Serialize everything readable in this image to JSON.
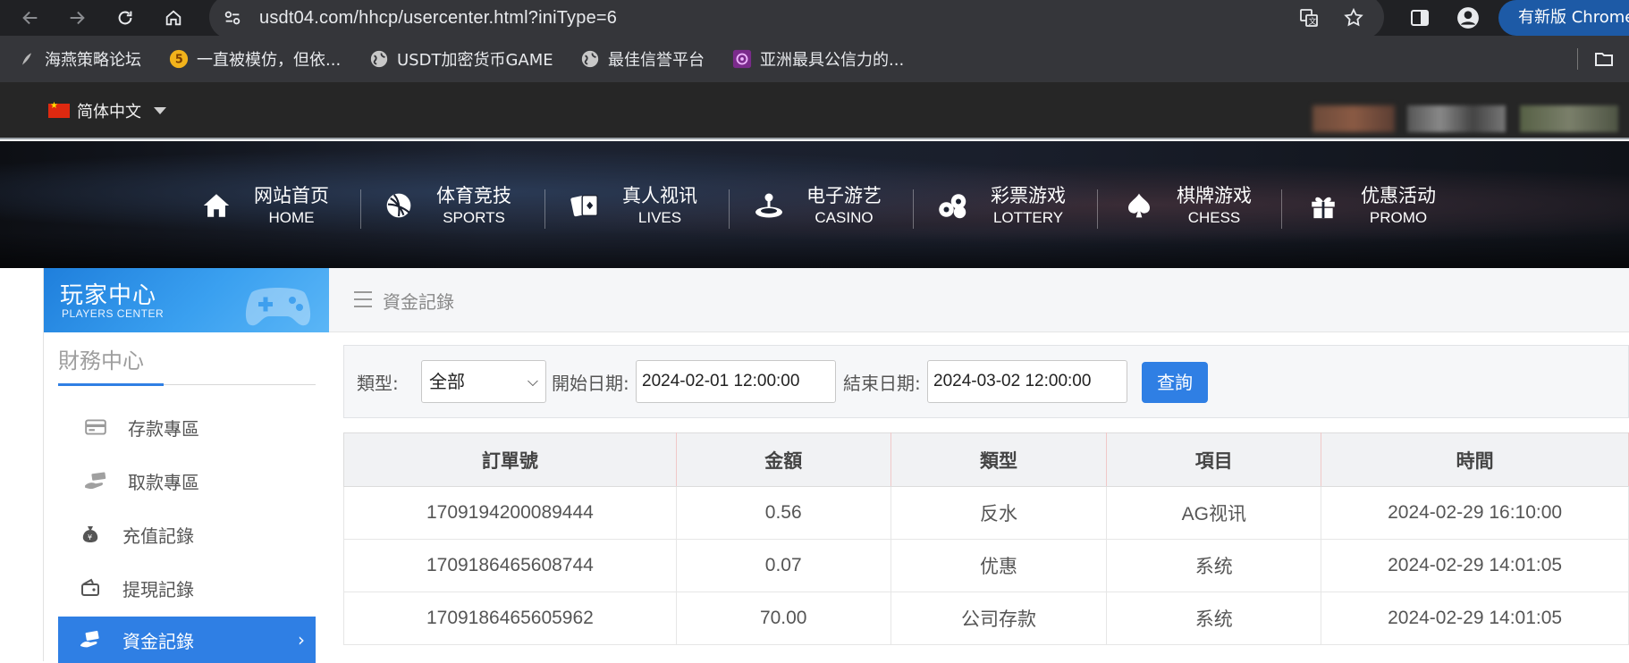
{
  "browser": {
    "url": "usdt04.com/hhcp/usercenter.html?iniType=6",
    "update_label": "有新版 Chrome",
    "bookmarks": [
      {
        "label": "海燕策略论坛"
      },
      {
        "label": "一直被模仿，但依..."
      },
      {
        "label": "USDT加密货币GAME"
      },
      {
        "label": "最佳信誉平台"
      },
      {
        "label": "亚洲最具公信力的..."
      }
    ]
  },
  "topbar": {
    "language": "简体中文"
  },
  "nav": [
    {
      "cn": "网站首页",
      "en": "HOME",
      "icon": "home-icon"
    },
    {
      "cn": "体育竞技",
      "en": "SPORTS",
      "icon": "ball-icon"
    },
    {
      "cn": "真人视讯",
      "en": "LIVES",
      "icon": "cards-icon"
    },
    {
      "cn": "电子游艺",
      "en": "CASINO",
      "icon": "joystick-icon"
    },
    {
      "cn": "彩票游戏",
      "en": "LOTTERY",
      "icon": "lottery-balls-icon"
    },
    {
      "cn": "棋牌游戏",
      "en": "CHESS",
      "icon": "spade-icon"
    },
    {
      "cn": "优惠活动",
      "en": "PROMO",
      "icon": "gift-icon"
    }
  ],
  "sidebar": {
    "header_cn": "玩家中心",
    "header_en": "PLAYERS CENTER",
    "section_title": "財務中心",
    "items": [
      {
        "label": "存款專區",
        "icon": "card-icon"
      },
      {
        "label": "取款專區",
        "icon": "hand-cash-icon"
      },
      {
        "label": "充值記錄",
        "icon": "money-bag-icon"
      },
      {
        "label": "提現記錄",
        "icon": "wallet-icon"
      },
      {
        "label": "資金記錄",
        "icon": "cash-hand-icon",
        "active": true
      }
    ]
  },
  "main": {
    "breadcrumb": "資金記錄",
    "filter": {
      "type_label": "類型:",
      "type_value": "全部",
      "start_label": "開始日期:",
      "start_value": "2024-02-01 12:00:00",
      "end_label": "結束日期:",
      "end_value": "2024-03-02 12:00:00",
      "query_label": "查詢"
    },
    "table": {
      "headers": [
        "訂單號",
        "金額",
        "類型",
        "項目",
        "時間"
      ],
      "rows": [
        [
          "1709194200089444",
          "0.56",
          "反水",
          "AG视讯",
          "2024-02-29 16:10:00"
        ],
        [
          "1709186465608744",
          "0.07",
          "优惠",
          "系统",
          "2024-02-29 14:01:05"
        ],
        [
          "1709186465605962",
          "70.00",
          "公司存款",
          "系统",
          "2024-02-29 14:01:05"
        ]
      ]
    }
  }
}
